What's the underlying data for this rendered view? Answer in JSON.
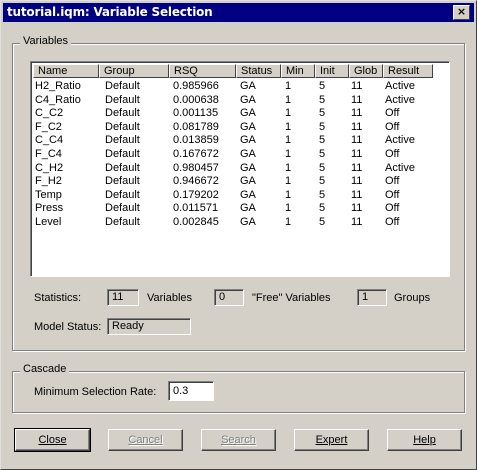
{
  "window": {
    "title": "tutorial.iqm: Variable Selection",
    "close_glyph": "×"
  },
  "variables_group": {
    "label": "Variables"
  },
  "table": {
    "columns": [
      "Name",
      "Group",
      "RSQ",
      "Status",
      "Min",
      "Init",
      "Glob",
      "Result"
    ],
    "rows": [
      [
        "H2_Ratio",
        "Default",
        "0.985966",
        "GA",
        "1",
        "5",
        "11",
        "Active"
      ],
      [
        "C4_Ratio",
        "Default",
        "0.000638",
        "GA",
        "1",
        "5",
        "11",
        "Active"
      ],
      [
        "C_C2",
        "Default",
        "0.001135",
        "GA",
        "1",
        "5",
        "11",
        "Off"
      ],
      [
        "F_C2",
        "Default",
        "0.081789",
        "GA",
        "1",
        "5",
        "11",
        "Off"
      ],
      [
        "C_C4",
        "Default",
        "0.013859",
        "GA",
        "1",
        "5",
        "11",
        "Active"
      ],
      [
        "F_C4",
        "Default",
        "0.167672",
        "GA",
        "1",
        "5",
        "11",
        "Off"
      ],
      [
        "C_H2",
        "Default",
        "0.980457",
        "GA",
        "1",
        "5",
        "11",
        "Active"
      ],
      [
        "F_H2",
        "Default",
        "0.946672",
        "GA",
        "1",
        "5",
        "11",
        "Off"
      ],
      [
        "Temp",
        "Default",
        "0.179202",
        "GA",
        "1",
        "5",
        "11",
        "Off"
      ],
      [
        "Press",
        "Default",
        "0.011571",
        "GA",
        "1",
        "5",
        "11",
        "Off"
      ],
      [
        "Level",
        "Default",
        "0.002845",
        "GA",
        "1",
        "5",
        "11",
        "Off"
      ]
    ]
  },
  "statistics": {
    "label": "Statistics:",
    "variables_count": "11",
    "variables_label": "Variables",
    "free_count": "0",
    "free_label": "\"Free\" Variables",
    "groups_count": "1",
    "groups_label": "Groups"
  },
  "model_status": {
    "label": "Model Status:",
    "value": "Ready"
  },
  "cascade": {
    "label": "Cascade",
    "min_rate_label": "Minimum Selection Rate:",
    "min_rate_value": "0.3"
  },
  "buttons": {
    "close": "Close",
    "cancel": "Cancel",
    "search": "Search",
    "expert": "Expert",
    "help": "Help"
  }
}
